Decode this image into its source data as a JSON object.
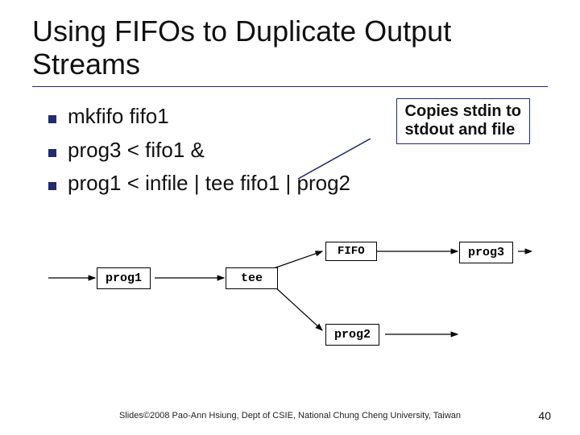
{
  "title": "Using FIFOs to Duplicate Output Streams",
  "bullets": [
    "mkfifo fifo1",
    "prog3 < fifo1 &",
    "prog1 < infile | tee fifo1 | prog2"
  ],
  "callout": {
    "line1": "Copies stdin to",
    "line2": "stdout and file"
  },
  "diagram": {
    "prog1": "prog1",
    "tee": "tee",
    "fifo": "FIFO",
    "prog2": "prog2",
    "prog3": "prog3"
  },
  "footer": "Slides©2008 Pao-Ann Hsiung, Dept of CSIE, National Chung Cheng University, Taiwan",
  "page": "40"
}
